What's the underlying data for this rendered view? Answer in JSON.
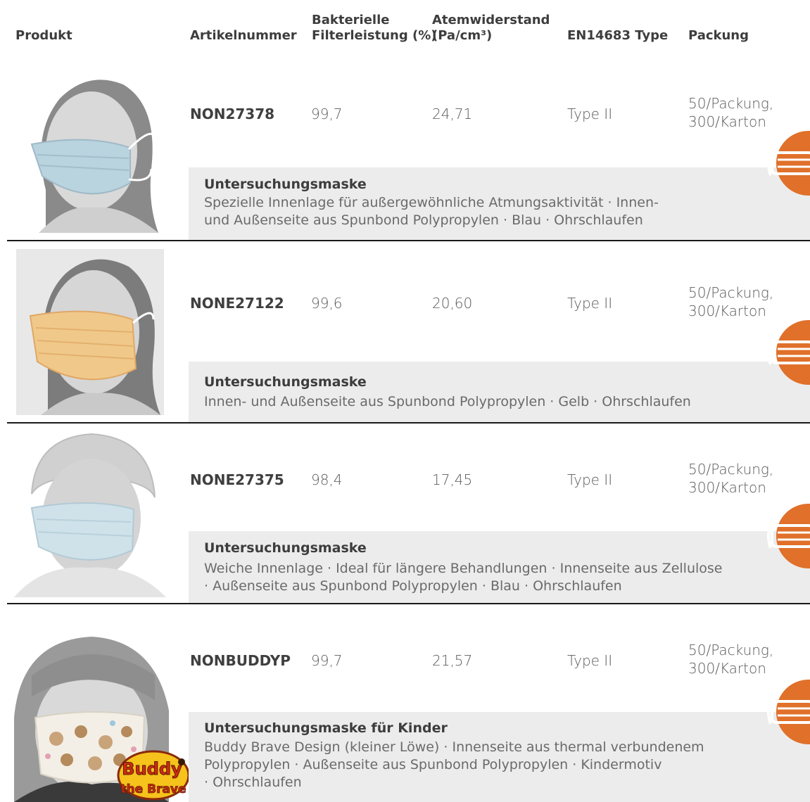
{
  "header": {
    "product": "Produkt",
    "article": "Artikelnummer",
    "bfe": "Bakterielle\nFilterleistung (%)",
    "resistance": "Atemwiderstand\n(Pa/cm³)",
    "type": "EN14683 Type",
    "packaging": "Packung"
  },
  "rows": [
    {
      "article": "NON27378",
      "bfe": "99,7",
      "resistance": "24,71",
      "type": "Type II",
      "packaging": "50/Packung,\n300/Karton",
      "title": "Untersuchungsmaske",
      "description": "Spezielle Innenlage für außergewöhnliche Atmungsaktivität · Innen-\nund Außenseite aus Spunbond Polypropylen · Blau · Ohrschlaufen",
      "mask_color": "#b9d3df"
    },
    {
      "article": "NONE27122",
      "bfe": "99,6",
      "resistance": "20,60",
      "type": "Type II",
      "packaging": "50/Packung,\n300/Karton",
      "title": "Untersuchungsmaske",
      "description": "Innen- und Außenseite aus Spunbond Polypropylen · Gelb · Ohrschlaufen",
      "mask_color": "#f0c98a"
    },
    {
      "article": "NONE27375",
      "bfe": "98,4",
      "resistance": "17,45",
      "type": "Type II",
      "packaging": "50/Packung,\n300/Karton",
      "title": "Untersuchungsmaske",
      "description": "Weiche Innenlage · Ideal für längere Behandlungen · Innenseite aus Zellulose\n· Außenseite aus Spunbond Polypropylen · Blau · Ohrschlaufen",
      "mask_color": "#cfe2ea"
    },
    {
      "article": "NONBUDDYP",
      "bfe": "99,7",
      "resistance": "21,57",
      "type": "Type II",
      "packaging": "50/Packung,\n300/Karton",
      "title": "Untersuchungsmaske für Kinder",
      "description": "Buddy Brave Design (kleiner Löwe) · Innenseite aus thermal verbundenem\nPolypropylen · Außenseite aus Spunbond Polypropylen · Kindermotiv\n· Ohrschlaufen",
      "mask_color": "#f3efe6"
    }
  ],
  "logo": {
    "line1": "Buddy",
    "line2": "the Brave"
  },
  "colors": {
    "accent": "#e0702a",
    "separator": "#1a1a1a",
    "desc_bg": "#ececec"
  },
  "icons": {
    "earloop": "earloop-mask-icon"
  }
}
